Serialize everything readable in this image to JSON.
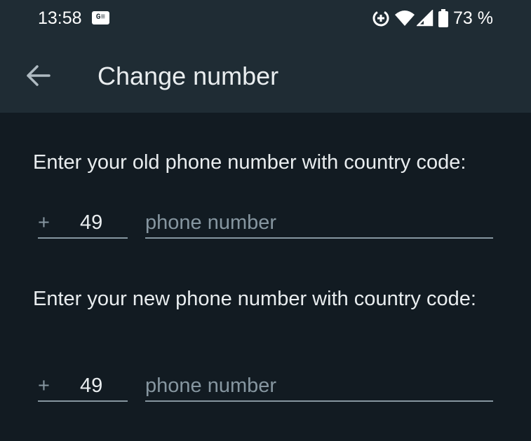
{
  "status_bar": {
    "time": "13:58",
    "notification_icon_text": "G≡",
    "battery_percent": "73 %",
    "icons": [
      "data-saver-icon",
      "wifi-icon",
      "cellular-signal-icon",
      "battery-icon"
    ]
  },
  "app_bar": {
    "back_icon": "arrow-back-icon",
    "title": "Change number"
  },
  "form": {
    "old_number": {
      "prompt": "Enter your old phone number with country code:",
      "plus": "+",
      "country_code": "49",
      "phone_placeholder": "phone number",
      "phone_value": ""
    },
    "new_number": {
      "prompt": "Enter your new phone number with country code:",
      "plus": "+",
      "country_code": "49",
      "phone_placeholder": "phone number",
      "phone_value": ""
    }
  },
  "colors": {
    "background": "#121b22",
    "app_bar": "#1f2c34",
    "primary_text": "#e9edef",
    "secondary_text": "#8696a0"
  }
}
